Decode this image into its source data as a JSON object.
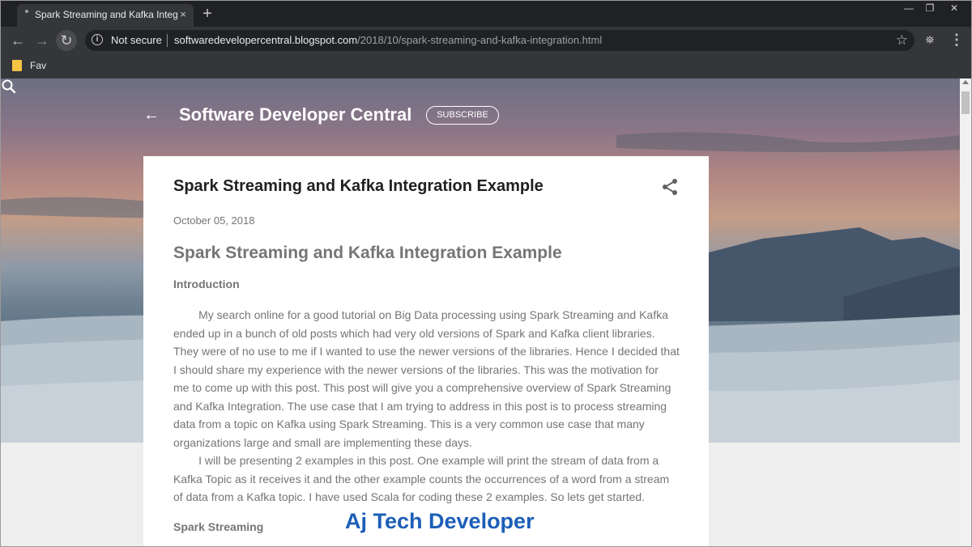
{
  "browser": {
    "tab": {
      "title": "Spark Streaming and Kafka Integ",
      "close_glyph": "×"
    },
    "new_tab_glyph": "+",
    "window_controls": [
      "—",
      "❐",
      "✕"
    ],
    "toolbar": {
      "security_label": "Not secure",
      "url_host": "softwaredevelopercentral.blogspot.com",
      "url_path": "/2018/10/spark-streaming-and-kafka-integration.html"
    },
    "bookmarks": [
      {
        "label": "Fav"
      }
    ]
  },
  "blog": {
    "title": "Software Developer Central",
    "subscribe_label": "SUBSCRIBE"
  },
  "post": {
    "title": "Spark Streaming and Kafka Integration Example",
    "date": "October 05, 2018",
    "article_heading": "Spark Streaming and Kafka Integration Example",
    "introduction_heading": "Introduction",
    "paragraph1_lines": [
      "        My search online for a good tutorial on Big Data processing using Spark Streaming and Kafka",
      "ended up in a bunch of old posts which had very old versions of Spark and Kafka client libraries.",
      "They were of no use to me if I wanted to use the newer versions of the libraries. Hence I decided that",
      "I should share my experience with the newer versions of the libraries. This was the motivation for",
      "me to come up with this post. This post will give you a comprehensive overview of Spark Streaming",
      "and Kafka Integration. The use case that I am trying to address in this post is to process streaming",
      "data from a topic on Kafka using Spark Streaming. This is a very common use case that many",
      "organizations large and small are implementing these days."
    ],
    "paragraph2_lines": [
      "        I will be presenting 2 examples in this post. One example will print the stream of data from a",
      "Kafka Topic as it receives it and the other example counts the occurrences of a word from a stream",
      "of data from a Kafka topic. I have used Scala for coding these 2 examples. So lets get started."
    ],
    "spark_heading": "Spark Streaming"
  },
  "watermark": "Aj Tech Developer",
  "colors": {
    "browser_dark": "#202124",
    "toolbar": "#35363a",
    "card_text": "#757575",
    "title_text": "#212121",
    "watermark": "#1d5fb8"
  }
}
